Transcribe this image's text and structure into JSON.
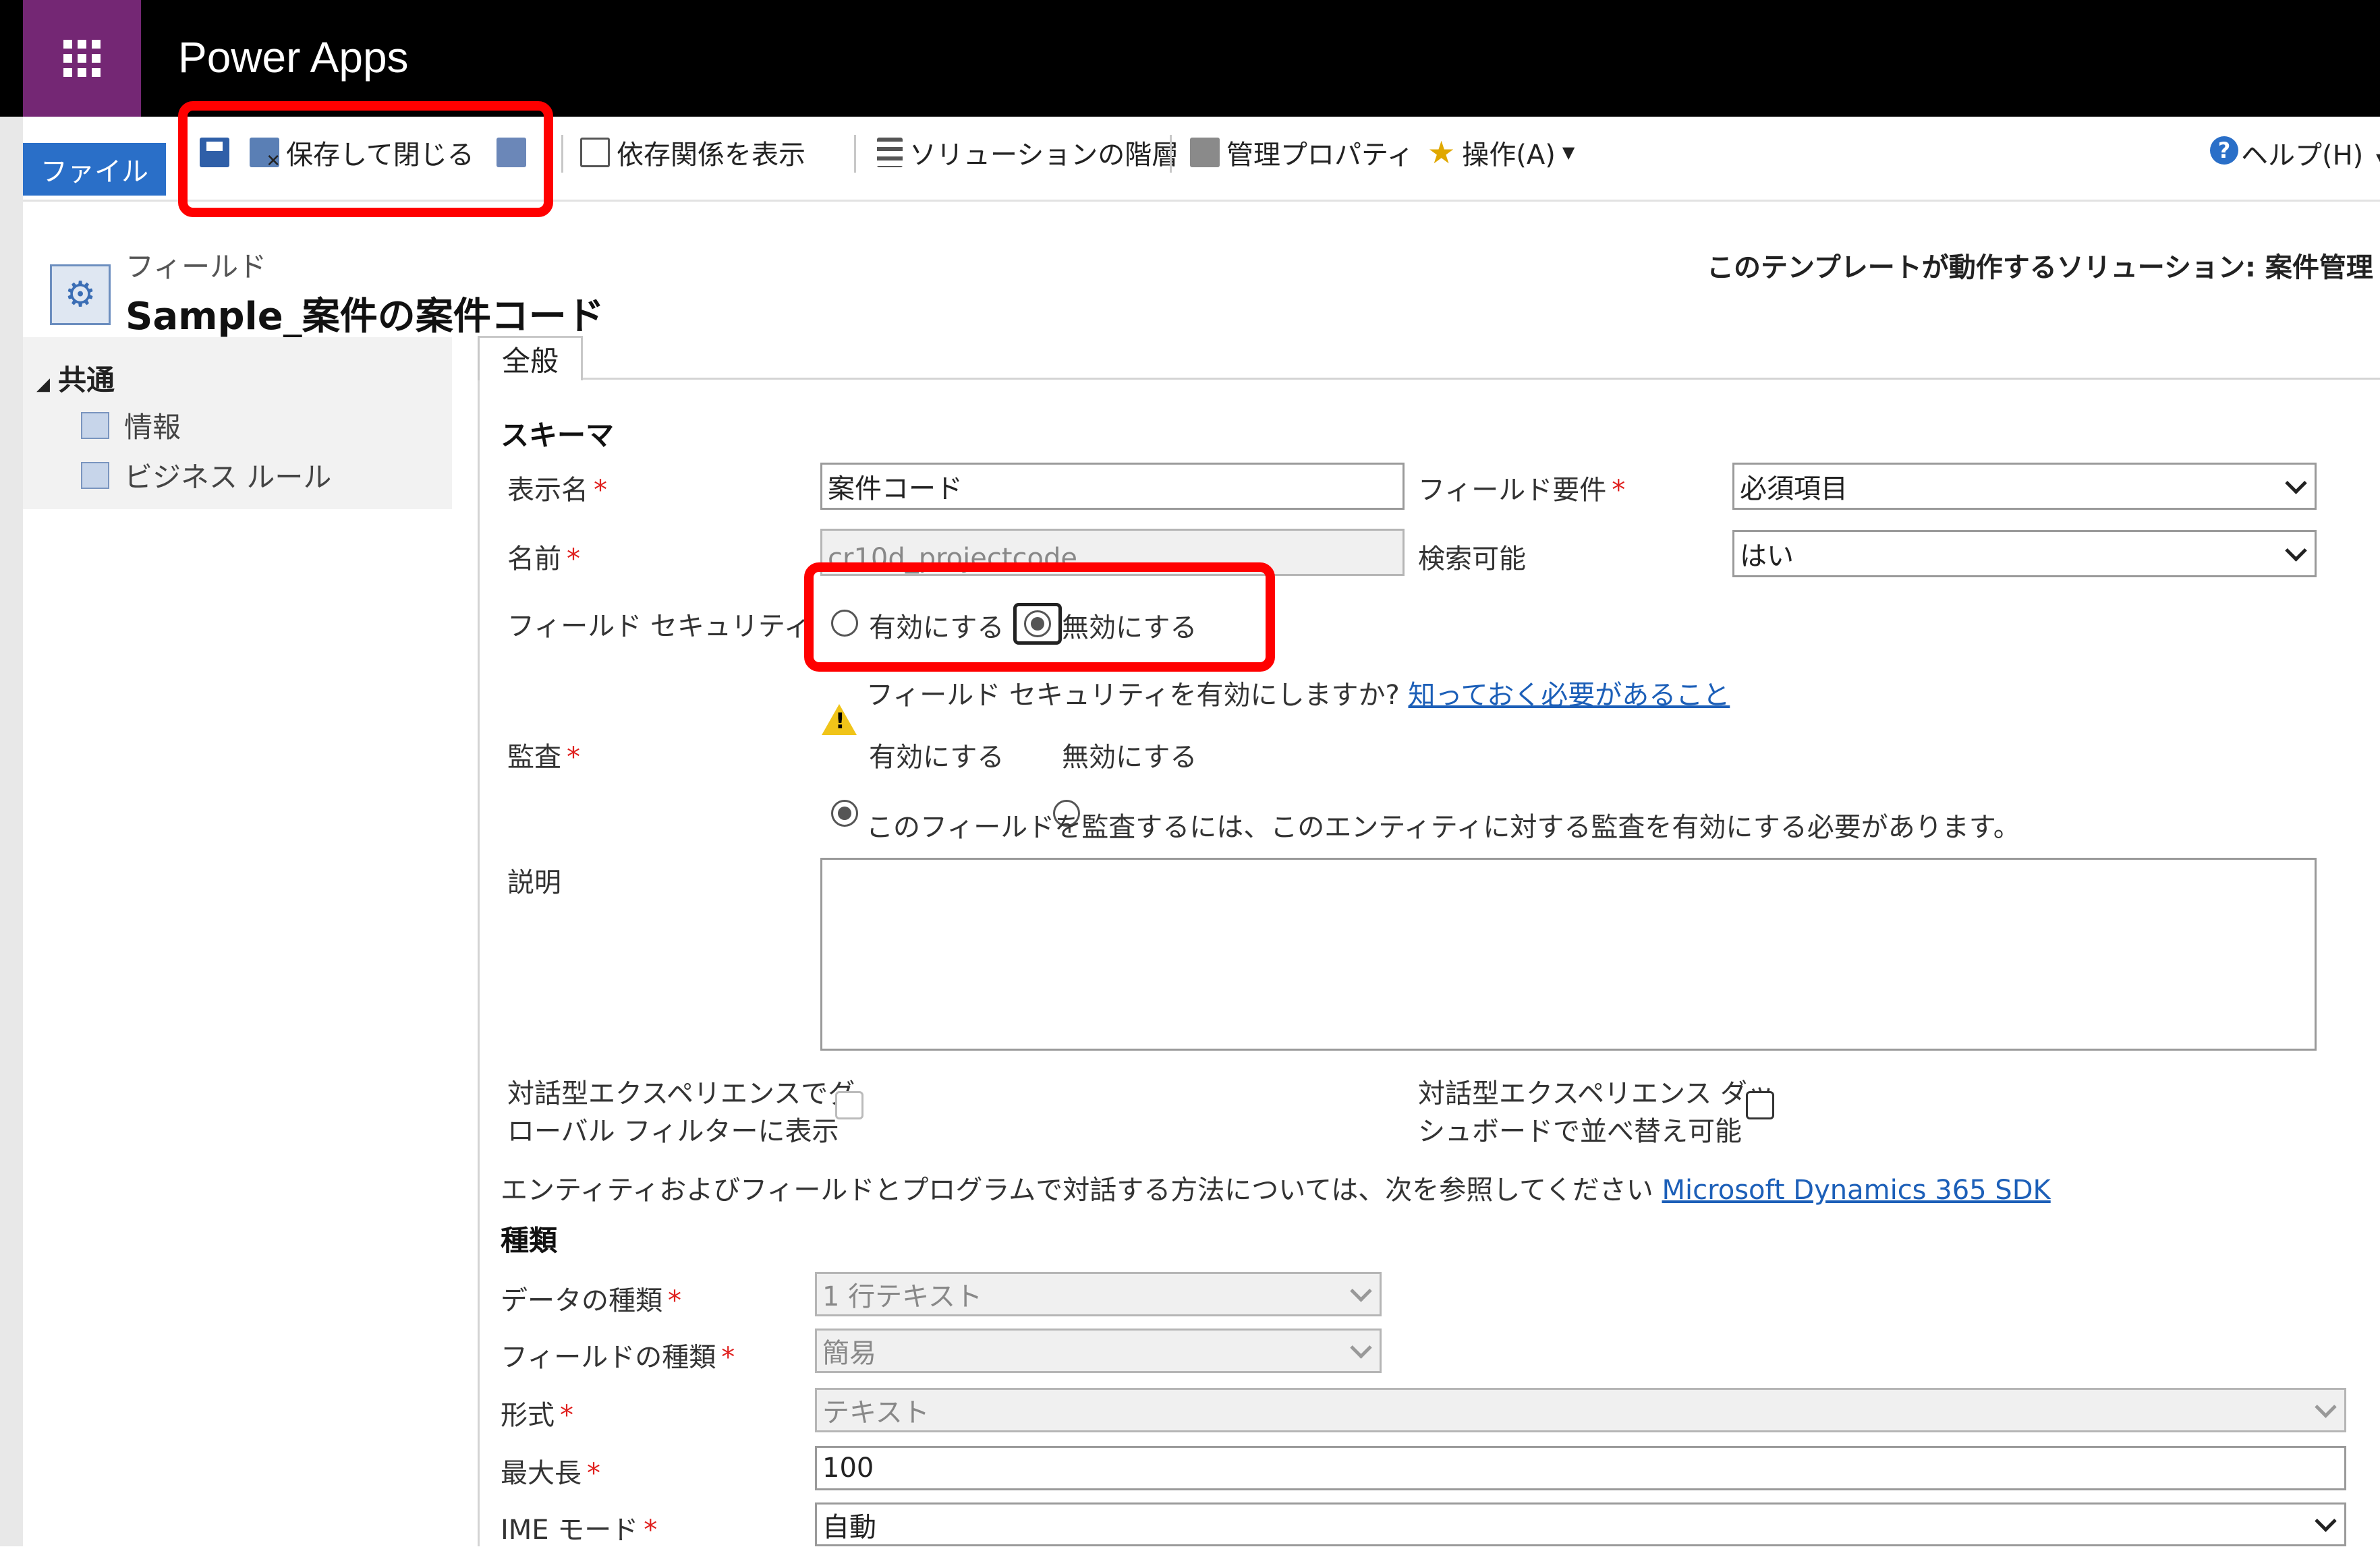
{
  "app": {
    "title": "Power Apps"
  },
  "ribbon": {
    "file_tab": "ファイル",
    "save_close": "保存して閉じる",
    "show_dependencies": "依存関係を表示",
    "solution_layers": "ソリューションの階層",
    "managed_properties": "管理プロパティ",
    "actions": "操作(A)",
    "help": "ヘルプ(H)"
  },
  "header": {
    "entity_type": "フィールド",
    "entity_name": "Sample_案件の案件コード",
    "solution_info": "このテンプレートが動作するソリューション: 案件管理"
  },
  "nav": {
    "group": "共通",
    "items": [
      {
        "label": "情報"
      },
      {
        "label": "ビジネス ルール"
      }
    ]
  },
  "tabs": {
    "general": "全般"
  },
  "form": {
    "schema_section": "スキーマ",
    "display_name": {
      "label": "表示名",
      "value": "案件コード"
    },
    "field_requirement": {
      "label": "フィールド要件",
      "value": "必須項目"
    },
    "name": {
      "label": "名前",
      "value": "cr10d_projectcode"
    },
    "searchable": {
      "label": "検索可能",
      "value": "はい"
    },
    "field_security": {
      "label": "フィールド セキュリティ",
      "enable": "有効にする",
      "disable": "無効にする",
      "warning": "フィールド セキュリティを有効にしますか?",
      "warning_link": "知っておく必要があること"
    },
    "audit": {
      "label": "監査",
      "enable": "有効にする",
      "disable": "無効にする",
      "warning": "このフィールドを監査するには、このエンティティに対する監査を有効にする必要があります。"
    },
    "description": {
      "label": "説明",
      "value": ""
    },
    "global_filter": {
      "line1": "対話型エクスペリエンスでグ",
      "line2": "ローバル フィルターに表示"
    },
    "sortable": {
      "line1": "対話型エクスペリエンス ダッ",
      "line2": "シュボードで並べ替え可能"
    },
    "sdk_note": "エンティティおよびフィールドとプログラムで対話する方法については、次を参照してください",
    "sdk_link": "Microsoft Dynamics 365 SDK",
    "type_section": "種類",
    "data_type": {
      "label": "データの種類",
      "value": "1 行テキスト"
    },
    "field_type": {
      "label": "フィールドの種類",
      "value": "簡易"
    },
    "format": {
      "label": "形式",
      "value": "テキスト"
    },
    "max_length": {
      "label": "最大長",
      "value": "100"
    },
    "ime_mode": {
      "label": "IME モード",
      "value": "自動"
    }
  },
  "colors": {
    "topbar": "#000000",
    "waffle": "#742774",
    "file_tab": "#2a6fc8",
    "highlight": "#ff0000",
    "required": "#e0201e",
    "link": "#1c5fb8"
  }
}
